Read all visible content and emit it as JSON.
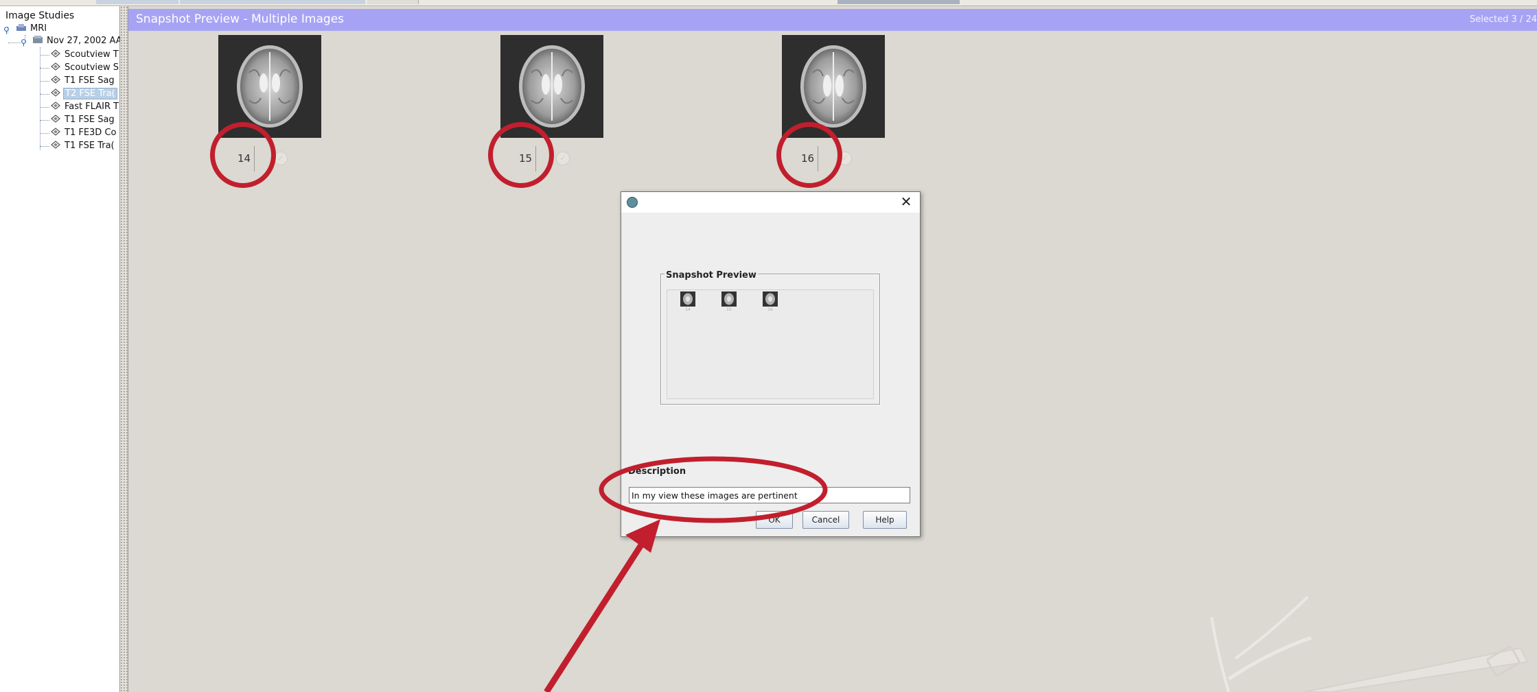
{
  "tree": {
    "root": "Image Studies",
    "modality": "MRI",
    "study": "Nov 27, 2002 AA",
    "series": [
      "Scoutview T",
      "Scoutview S",
      "T1 FSE Sag",
      "T2 FSE Tra(",
      "Fast FLAIR T",
      "T1 FSE Sag",
      "T1 FE3D Co",
      "T1 FSE Tra("
    ],
    "selected_index": 3
  },
  "header": {
    "title": "Snapshot Preview - Multiple Images",
    "selection_count": "Selected 3 / 24"
  },
  "thumbnails": [
    {
      "number": "14"
    },
    {
      "number": "15"
    },
    {
      "number": "16"
    }
  ],
  "dialog": {
    "close_glyph": "✕",
    "group_label": "Snapshot Preview",
    "description_label": "Description",
    "description_value": "In my view these images are pertinent",
    "buttons": {
      "ok": "OK",
      "cancel": "Cancel",
      "help": "Help"
    }
  },
  "colors": {
    "header_bg": "#a7a3f4",
    "annotation_red": "#c11f2d",
    "selection_bg": "#b8cfe5"
  }
}
